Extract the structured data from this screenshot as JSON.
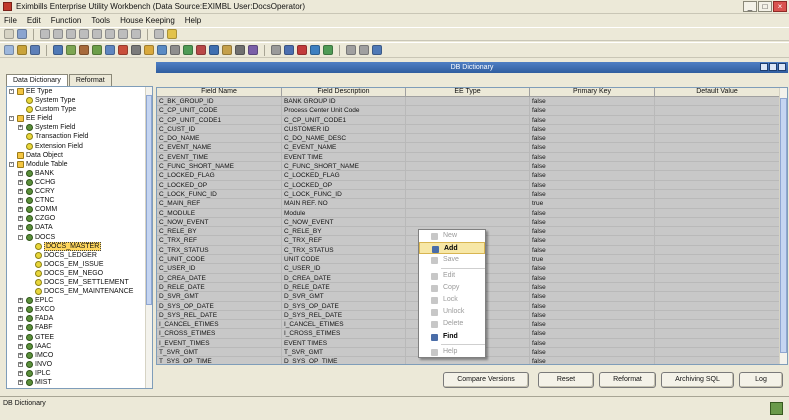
{
  "window": {
    "title": "Eximbills Enterprise Utility Workbench  (Data Source:EXIMBL User:DocsOperator)"
  },
  "menu": [
    "File",
    "Edit",
    "Function",
    "Tools",
    "House Keeping",
    "Help"
  ],
  "window_buttons": [
    "_",
    "□",
    "×"
  ],
  "tabs": [
    "Data Dictionary",
    "Reformat"
  ],
  "inner_window": {
    "title": "DB Dictionary"
  },
  "tree": [
    {
      "label": "EE Type",
      "level": 0,
      "exp": "-",
      "icon": "db"
    },
    {
      "label": "System Type",
      "level": 1,
      "exp": "",
      "icon": "dot"
    },
    {
      "label": "Custom Type",
      "level": 1,
      "exp": "",
      "icon": "dot"
    },
    {
      "label": "EE Field",
      "level": 0,
      "exp": "-",
      "icon": "db"
    },
    {
      "label": "System Field",
      "level": 1,
      "exp": "+",
      "icon": "gear"
    },
    {
      "label": "Transaction Field",
      "level": 1,
      "exp": "",
      "icon": "dot"
    },
    {
      "label": "Extension Field",
      "level": 1,
      "exp": "",
      "icon": "dot"
    },
    {
      "label": "Data Object",
      "level": 0,
      "exp": "",
      "icon": "db"
    },
    {
      "label": "Module Table",
      "level": 0,
      "exp": "-",
      "icon": "db"
    },
    {
      "label": "BANK",
      "level": 1,
      "exp": "+",
      "icon": "gear"
    },
    {
      "label": "CCHG",
      "level": 1,
      "exp": "+",
      "icon": "gear"
    },
    {
      "label": "CCRY",
      "level": 1,
      "exp": "+",
      "icon": "gear"
    },
    {
      "label": "CTNC",
      "level": 1,
      "exp": "+",
      "icon": "gear"
    },
    {
      "label": "COMM",
      "level": 1,
      "exp": "+",
      "icon": "gear"
    },
    {
      "label": "CZGO",
      "level": 1,
      "exp": "+",
      "icon": "gear"
    },
    {
      "label": "DATA",
      "level": 1,
      "exp": "+",
      "icon": "gear"
    },
    {
      "label": "DOCS",
      "level": 1,
      "exp": "-",
      "icon": "gear"
    },
    {
      "label": "DOCS_MASTER",
      "level": 2,
      "exp": "",
      "icon": "dot",
      "selected": true
    },
    {
      "label": "DOCS_LEDGER",
      "level": 2,
      "exp": "",
      "icon": "dot"
    },
    {
      "label": "DOCS_EM_ISSUE",
      "level": 2,
      "exp": "",
      "icon": "dot"
    },
    {
      "label": "DOCS_EM_NEGO",
      "level": 2,
      "exp": "",
      "icon": "dot"
    },
    {
      "label": "DOCS_EM_SETTLEMENT",
      "level": 2,
      "exp": "",
      "icon": "dot"
    },
    {
      "label": "DOCS_EM_MAINTENANCE",
      "level": 2,
      "exp": "",
      "icon": "dot"
    },
    {
      "label": "EPLC",
      "level": 1,
      "exp": "+",
      "icon": "gear"
    },
    {
      "label": "EXCO",
      "level": 1,
      "exp": "+",
      "icon": "gear"
    },
    {
      "label": "FADA",
      "level": 1,
      "exp": "+",
      "icon": "gear"
    },
    {
      "label": "FABF",
      "level": 1,
      "exp": "+",
      "icon": "gear"
    },
    {
      "label": "GTEE",
      "level": 1,
      "exp": "+",
      "icon": "gear"
    },
    {
      "label": "IAAC",
      "level": 1,
      "exp": "+",
      "icon": "gear"
    },
    {
      "label": "IMCO",
      "level": 1,
      "exp": "+",
      "icon": "gear"
    },
    {
      "label": "INVO",
      "level": 1,
      "exp": "+",
      "icon": "gear"
    },
    {
      "label": "IPLC",
      "level": 1,
      "exp": "+",
      "icon": "gear"
    },
    {
      "label": "MIST",
      "level": 1,
      "exp": "+",
      "icon": "gear"
    }
  ],
  "table": {
    "columns": [
      "Field Name",
      "Field Description",
      "EE Type",
      "Primary Key",
      "Default Value"
    ],
    "rows": [
      [
        "C_BK_GROUP_ID",
        "BANK GROUP ID",
        "",
        "false",
        ""
      ],
      [
        "C_CP_UNIT_CODE",
        "Process Center Unit Code",
        "",
        "false",
        ""
      ],
      [
        "C_CP_UNIT_CODE1",
        "C_CP_UNIT_CODE1",
        "",
        "false",
        ""
      ],
      [
        "C_CUST_ID",
        "CUSTOMER ID",
        "",
        "false",
        ""
      ],
      [
        "C_DO_NAME",
        "C_DO_NAME_DESC",
        "",
        "false",
        ""
      ],
      [
        "C_EVENT_NAME",
        "C_EVENT_NAME",
        "",
        "false",
        ""
      ],
      [
        "C_EVENT_TIME",
        "EVENT TIME",
        "",
        "false",
        ""
      ],
      [
        "C_FUNC_SHORT_NAME",
        "C_FUNC_SHORT_NAME",
        "",
        "false",
        ""
      ],
      [
        "C_LOCKED_FLAG",
        "C_LOCKED_FLAG",
        "",
        "false",
        ""
      ],
      [
        "C_LOCKED_OP",
        "C_LOCKED_OP",
        "",
        "false",
        ""
      ],
      [
        "C_LOCK_FUNC_ID",
        "C_LOCK_FUNC_ID",
        "",
        "false",
        ""
      ],
      [
        "C_MAIN_REF",
        "MAIN REF. NO",
        "",
        "true",
        ""
      ],
      [
        "C_MODULE",
        "Module",
        "",
        "false",
        ""
      ],
      [
        "C_NOW_EVENT",
        "C_NOW_EVENT",
        "",
        "false",
        ""
      ],
      [
        "C_RELE_BY",
        "C_RELE_BY",
        "",
        "false",
        ""
      ],
      [
        "C_TRX_REF",
        "C_TRX_REF",
        "",
        "false",
        ""
      ],
      [
        "C_TRX_STATUS",
        "C_TRX_STATUS",
        "",
        "false",
        ""
      ],
      [
        "C_UNIT_CODE",
        "UNIT CODE",
        "",
        "true",
        ""
      ],
      [
        "C_USER_ID",
        "C_USER_ID",
        "",
        "false",
        ""
      ],
      [
        "D_CREA_DATE",
        "D_CREA_DATE",
        "",
        "false",
        ""
      ],
      [
        "D_RELE_DATE",
        "D_RELE_DATE",
        "",
        "false",
        ""
      ],
      [
        "D_SVR_GMT",
        "D_SVR_GMT",
        "",
        "false",
        ""
      ],
      [
        "D_SYS_OP_DATE",
        "D_SYS_OP_DATE",
        "",
        "false",
        ""
      ],
      [
        "D_SYS_REL_DATE",
        "D_SYS_REL_DATE",
        "",
        "false",
        ""
      ],
      [
        "I_CANCEL_ETIMES",
        "I_CANCEL_ETIMES",
        "",
        "false",
        ""
      ],
      [
        "I_CROSS_ETIMES",
        "I_CROSS_ETIMES",
        "",
        "false",
        ""
      ],
      [
        "I_EVENT_TIMES",
        "EVENT TIMES",
        "",
        "false",
        ""
      ],
      [
        "T_SVR_GMT",
        "T_SVR_GMT",
        "",
        "false",
        ""
      ],
      [
        "T_SYS_OP_TIME",
        "D_SYS_OP_TIME",
        "",
        "false",
        ""
      ]
    ]
  },
  "context_menu": [
    {
      "label": "New",
      "enabled": false
    },
    {
      "label": "Add",
      "enabled": true,
      "hover": true
    },
    {
      "label": "Save",
      "enabled": false,
      "sep_after": true
    },
    {
      "label": "Edit",
      "enabled": false
    },
    {
      "label": "Copy",
      "enabled": false
    },
    {
      "label": "Lock",
      "enabled": false
    },
    {
      "label": "Unlock",
      "enabled": false
    },
    {
      "label": "Delete",
      "enabled": false
    },
    {
      "label": "Find",
      "enabled": true,
      "sep_after": true
    },
    {
      "label": "Help",
      "enabled": false
    }
  ],
  "buttons": {
    "compare": "Compare Versions",
    "reset": "Reset",
    "reformat": "Reformat",
    "archiving": "Archiving SQL",
    "log": "Log"
  },
  "status": {
    "text": "DB Dictionary"
  }
}
